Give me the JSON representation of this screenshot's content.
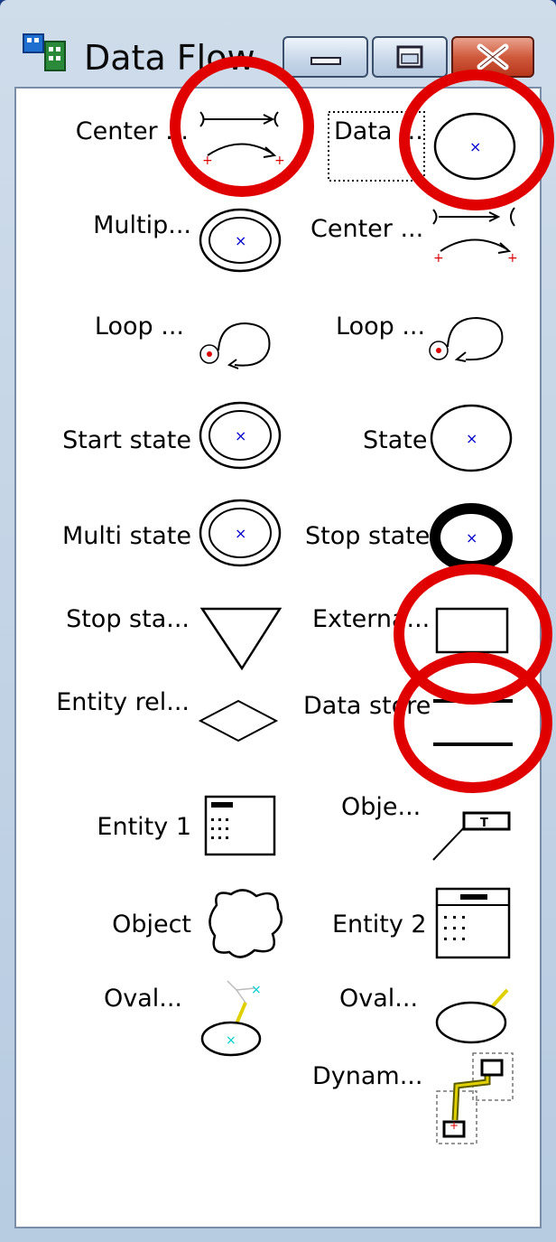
{
  "window": {
    "title": "Data Flow"
  },
  "left_items": [
    {
      "label": "Center ..."
    },
    {
      "label": "Multip..."
    },
    {
      "label": "Loop ..."
    },
    {
      "label": "Start state"
    },
    {
      "label": "Multi state"
    },
    {
      "label": "Stop sta..."
    },
    {
      "label": "Entity rel..."
    },
    {
      "label": "Entity 1"
    },
    {
      "label": "Object"
    },
    {
      "label": "Oval..."
    }
  ],
  "right_items": [
    {
      "label": "Data ..."
    },
    {
      "label": "Center ..."
    },
    {
      "label": "Loop ..."
    },
    {
      "label": "State"
    },
    {
      "label": "Stop state"
    },
    {
      "label": "Externa..."
    },
    {
      "label": "Data store"
    },
    {
      "label": "Obje..."
    },
    {
      "label": "Entity 2"
    },
    {
      "label": "Oval..."
    },
    {
      "label": "Dynam..."
    }
  ],
  "annotation_color": "#e00000"
}
